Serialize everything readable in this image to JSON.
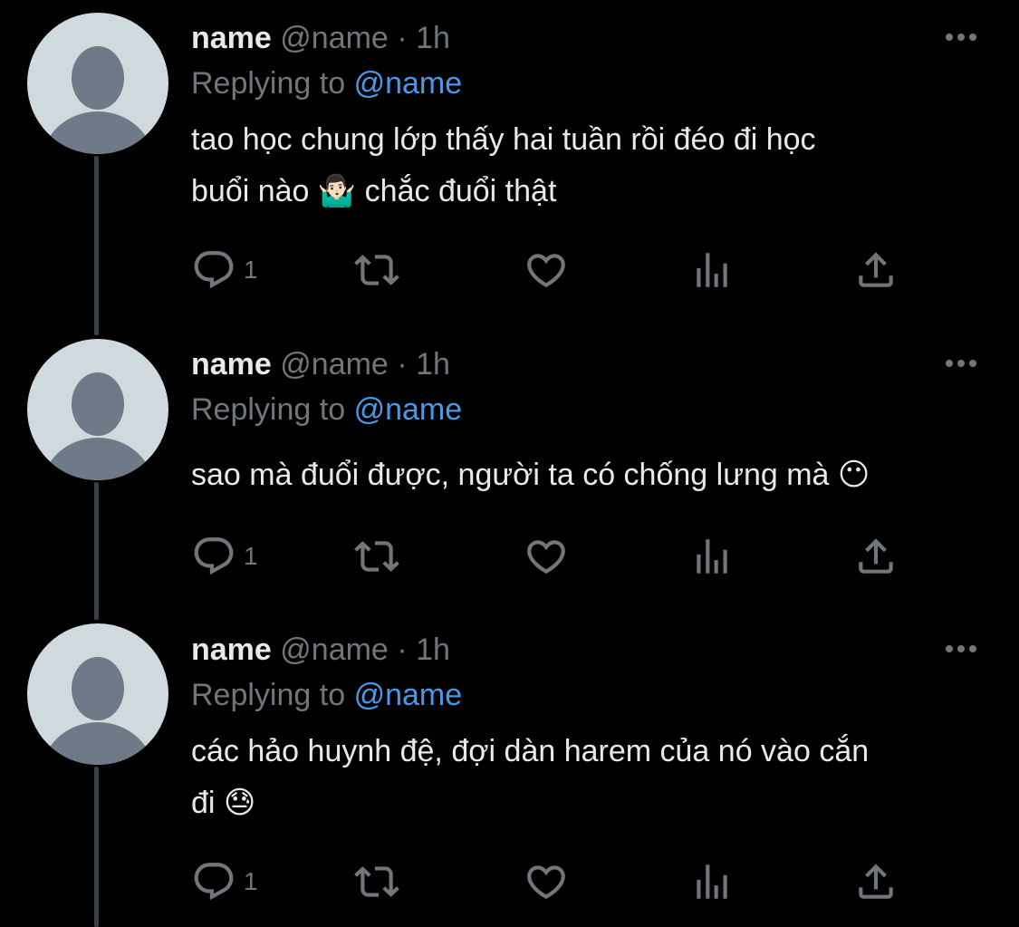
{
  "tweets": [
    {
      "name": "name",
      "handle": "@name",
      "separator": "·",
      "time": "1h",
      "replying_label": "Replying to",
      "replying_to": "@name",
      "text_line1": "tao học chung lớp thấy hai tuần rồi đéo đi học",
      "text_line2": "buổi nào 🤷🏻‍♂️ chắc đuổi thật",
      "reply_count": "1"
    },
    {
      "name": "name",
      "handle": "@name",
      "separator": "·",
      "time": "1h",
      "replying_label": "Replying to",
      "replying_to": "@name",
      "text_line1": "sao mà đuổi được, người ta có chống lưng mà 😶",
      "text_line2": "",
      "reply_count": "1"
    },
    {
      "name": "name",
      "handle": "@name",
      "separator": "·",
      "time": "1h",
      "replying_label": "Replying to",
      "replying_to": "@name",
      "text_line1": "các hảo huynh đệ, đợi dàn harem của nó vào cắn",
      "text_line2": "đi 😓",
      "reply_count": "1"
    }
  ],
  "icons": {
    "reply": "reply-icon",
    "retweet": "retweet-icon",
    "like": "heart-icon",
    "views": "analytics-icon",
    "share": "share-icon",
    "more": "more-dots-icon"
  },
  "colors": {
    "background": "#000000",
    "text": "#e7e9ea",
    "muted": "#71767b",
    "mention": "#4a99e9",
    "avatar_bg": "#cfd9de",
    "avatar_fg": "#6e7a87",
    "thread_line": "#3b4148"
  }
}
